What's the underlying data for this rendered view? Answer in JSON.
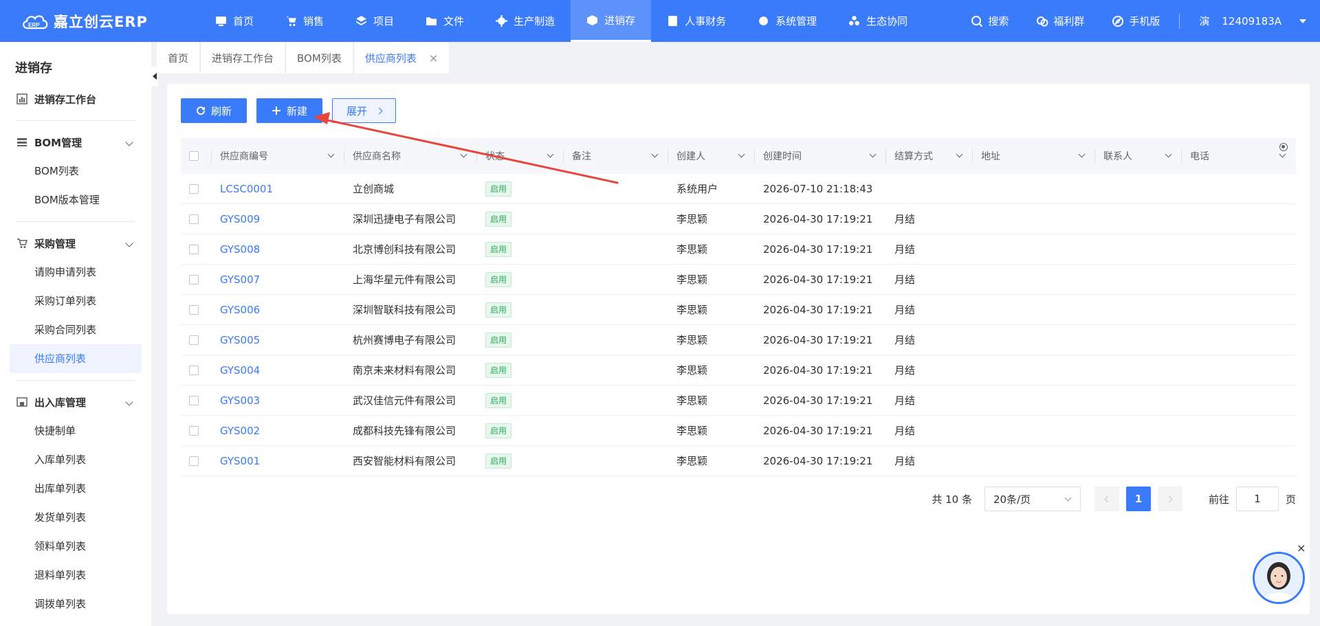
{
  "header": {
    "logo_text": "嘉立创云ERP",
    "logo_badge": "ERP",
    "nav": [
      {
        "label": "首页",
        "icon": "monitor-icon"
      },
      {
        "label": "销售",
        "icon": "cart-icon"
      },
      {
        "label": "项目",
        "icon": "layers-icon"
      },
      {
        "label": "文件",
        "icon": "folder-icon"
      },
      {
        "label": "生产制造",
        "icon": "gear-icon"
      },
      {
        "label": "进销存",
        "icon": "cube-icon",
        "active": true
      },
      {
        "label": "人事财务",
        "icon": "book-icon"
      },
      {
        "label": "系统管理",
        "icon": "settings-icon"
      },
      {
        "label": "生态协同",
        "icon": "network-icon"
      }
    ],
    "tools": {
      "search": "搜索",
      "welfare": "福利群",
      "mobile": "手机版"
    },
    "user": {
      "avatar_char": "演",
      "account": "12409183A"
    }
  },
  "sidebar": {
    "title": "进销存",
    "workbench": "进销存工作台",
    "groups": [
      {
        "label": "BOM管理",
        "items": [
          "BOM列表",
          "BOM版本管理"
        ]
      },
      {
        "label": "采购管理",
        "items": [
          "请购申请列表",
          "采购订单列表",
          "采购合同列表",
          "供应商列表"
        ]
      },
      {
        "label": "出入库管理",
        "items": [
          "快捷制单",
          "入库单列表",
          "出库单列表",
          "发货单列表",
          "领料单列表",
          "退料单列表",
          "调拨单列表"
        ]
      }
    ]
  },
  "tabs": [
    {
      "label": "首页"
    },
    {
      "label": "进销存工作台"
    },
    {
      "label": "BOM列表"
    },
    {
      "label": "供应商列表",
      "active": true
    }
  ],
  "toolbar": {
    "refresh": "刷新",
    "create": "新建",
    "expand": "展开"
  },
  "table": {
    "columns": [
      "供应商编号",
      "供应商名称",
      "状态",
      "备注",
      "创建人",
      "创建时间",
      "结算方式",
      "地址",
      "联系人",
      "电话"
    ],
    "rows": [
      {
        "code": "LCSC0001",
        "name": "立创商城",
        "status": "启用",
        "remark": "",
        "creator": "系统用户",
        "created": "2026-07-10 21:18:43",
        "settle": "",
        "address": "",
        "contact": "",
        "phone": ""
      },
      {
        "code": "GYS009",
        "name": "深圳迅捷电子有限公司",
        "status": "启用",
        "remark": "",
        "creator": "李思颖",
        "created": "2026-04-30 17:19:21",
        "settle": "月结",
        "address": "",
        "contact": "",
        "phone": ""
      },
      {
        "code": "GYS008",
        "name": "北京博创科技有限公司",
        "status": "启用",
        "remark": "",
        "creator": "李思颖",
        "created": "2026-04-30 17:19:21",
        "settle": "月结",
        "address": "",
        "contact": "",
        "phone": ""
      },
      {
        "code": "GYS007",
        "name": "上海华星元件有限公司",
        "status": "启用",
        "remark": "",
        "creator": "李思颖",
        "created": "2026-04-30 17:19:21",
        "settle": "月结",
        "address": "",
        "contact": "",
        "phone": ""
      },
      {
        "code": "GYS006",
        "name": "深圳智联科技有限公司",
        "status": "启用",
        "remark": "",
        "creator": "李思颖",
        "created": "2026-04-30 17:19:21",
        "settle": "月结",
        "address": "",
        "contact": "",
        "phone": ""
      },
      {
        "code": "GYS005",
        "name": "杭州赛博电子有限公司",
        "status": "启用",
        "remark": "",
        "creator": "李思颖",
        "created": "2026-04-30 17:19:21",
        "settle": "月结",
        "address": "",
        "contact": "",
        "phone": ""
      },
      {
        "code": "GYS004",
        "name": "南京未来材料有限公司",
        "status": "启用",
        "remark": "",
        "creator": "李思颖",
        "created": "2026-04-30 17:19:21",
        "settle": "月结",
        "address": "",
        "contact": "",
        "phone": ""
      },
      {
        "code": "GYS003",
        "name": "武汉佳信元件有限公司",
        "status": "启用",
        "remark": "",
        "creator": "李思颖",
        "created": "2026-04-30 17:19:21",
        "settle": "月结",
        "address": "",
        "contact": "",
        "phone": ""
      },
      {
        "code": "GYS002",
        "name": "成都科技先锋有限公司",
        "status": "启用",
        "remark": "",
        "creator": "李思颖",
        "created": "2026-04-30 17:19:21",
        "settle": "月结",
        "address": "",
        "contact": "",
        "phone": ""
      },
      {
        "code": "GYS001",
        "name": "西安智能材料有限公司",
        "status": "启用",
        "remark": "",
        "creator": "李思颖",
        "created": "2026-04-30 17:19:21",
        "settle": "月结",
        "address": "",
        "contact": "",
        "phone": ""
      }
    ]
  },
  "pagination": {
    "total": "共 10 条",
    "page_size": "20条/页",
    "current": "1",
    "goto_label": "前往",
    "goto_value": "1",
    "page_unit": "页"
  },
  "colors": {
    "primary": "#3a7bfb",
    "status_green": "#2dab5c",
    "annotation_red": "#e8453c"
  }
}
